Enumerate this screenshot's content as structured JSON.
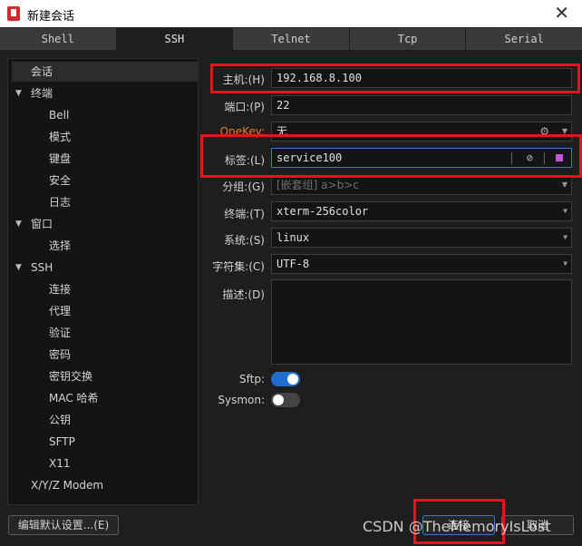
{
  "window": {
    "title": "新建会话",
    "close_glyph": "✕"
  },
  "tabs": [
    "Shell",
    "SSH",
    "Telnet",
    "Tcp",
    "Serial"
  ],
  "tree": [
    "会话",
    "终端",
    "Bell",
    "模式",
    "键盘",
    "安全",
    "日志",
    "窗口",
    "选择",
    "SSH",
    "连接",
    "代理",
    "验证",
    "密码",
    "密钥交换",
    "MAC 哈希",
    "公钥",
    "SFTP",
    "X11",
    "X/Y/Z Modem"
  ],
  "form": {
    "host_label": "主机:(H)",
    "host_value": "192.168.8.100",
    "port_label": "端口:(P)",
    "port_value": "22",
    "onekey_label": "OneKey:",
    "onekey_value": "无",
    "tag_label": "标签:(L)",
    "tag_value": "service100",
    "group_label": "分组:(G)",
    "group_placeholder": "[嵌套组] a>b>c",
    "terminal_label": "终端:(T)",
    "terminal_value": "xterm-256color",
    "system_label": "系统:(S)",
    "system_value": "linux",
    "charset_label": "字符集:(C)",
    "charset_value": "UTF-8",
    "desc_label": "描述:(D)",
    "sftp_label": "Sftp:",
    "sftp_on": true,
    "sysmon_label": "Sysmon:",
    "sysmon_on": false
  },
  "buttons": {
    "edit_defaults": "编辑默认设置...(E)",
    "connect": "连接",
    "cancel": "取消"
  },
  "watermark": "CSDN @TheMemoryIsLost",
  "colors": {
    "highlight": "#e8141c",
    "accent": "#1f6fd1",
    "onekey": "#e87d1f",
    "tag_color": "#c653d8"
  }
}
